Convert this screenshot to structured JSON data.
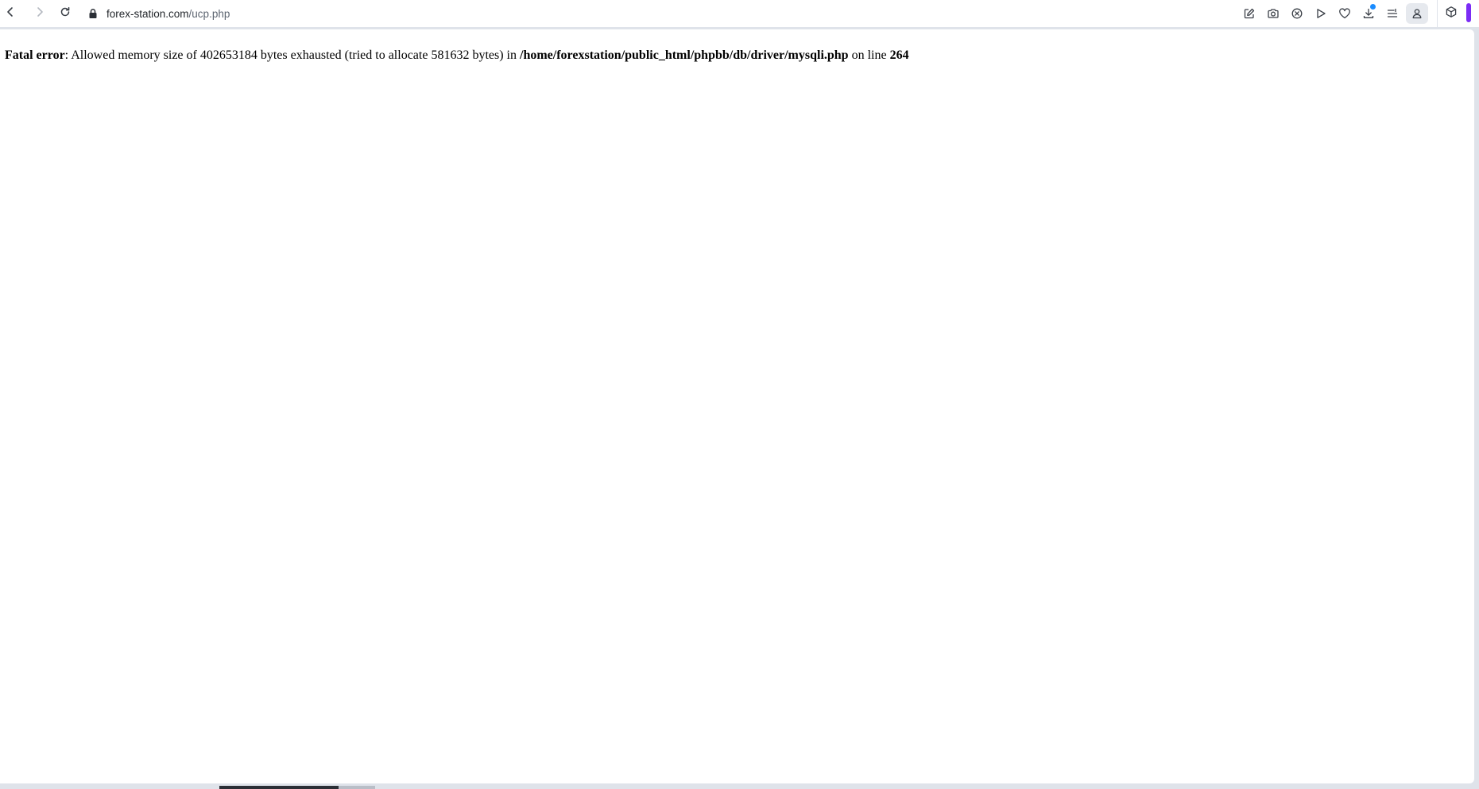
{
  "browser": {
    "url_host": "forex-station.com",
    "url_path": "/ucp.php",
    "icons": {
      "back": "chevron-left-icon",
      "forward": "chevron-right-icon",
      "reload": "reload-icon",
      "lock": "lock-icon",
      "toolbar": [
        "edit-icon",
        "camera-icon",
        "close-circle-icon",
        "play-icon",
        "heart-icon",
        "download-icon",
        "menu-icon",
        "profile-icon"
      ],
      "sidebar": "cube-icon"
    },
    "colors": {
      "download_badge": "#1a8cff",
      "sidebar_accent": "#7b2cf5"
    }
  },
  "error": {
    "label": "Fatal error",
    "message": ": Allowed memory size of 402653184 bytes exhausted (tried to allocate 581632 bytes) in ",
    "file": "/home/forexstation/public_html/phpbb/db/driver/mysqli.php",
    "on_line_text": " on line ",
    "line": "264"
  }
}
